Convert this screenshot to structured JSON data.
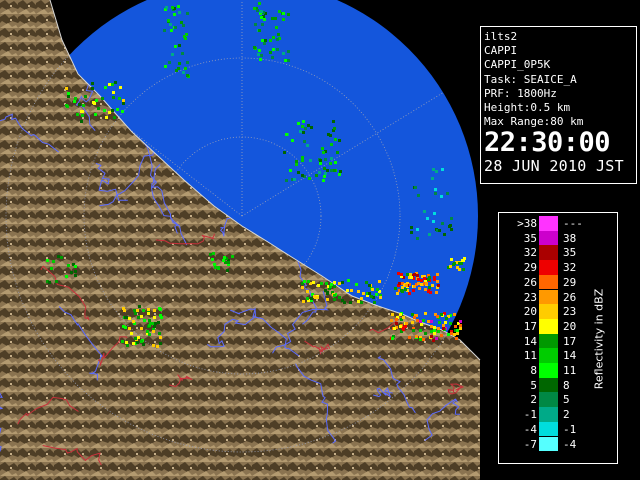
{
  "info": {
    "station": "ilts2",
    "product": "CAPPI",
    "product_code": "CAPPI_0P5K",
    "task": "Task: SEAICE_A",
    "prf": "PRF: 1800Hz",
    "height": "Height:0.5 km",
    "max_range": "Max Range:80 km",
    "time": "22:30:00",
    "date": "28 JUN 2010 JST"
  },
  "legend": {
    "title": "Reflectivity in dBZ",
    "rows": [
      {
        "lo": ">38",
        "hi": "---",
        "color": "#ff33ff"
      },
      {
        "lo": "35",
        "hi": "38",
        "color": "#cc00cc"
      },
      {
        "lo": "32",
        "hi": "35",
        "color": "#aa0000"
      },
      {
        "lo": "29",
        "hi": "32",
        "color": "#ee0000"
      },
      {
        "lo": "26",
        "hi": "29",
        "color": "#ff6600"
      },
      {
        "lo": "23",
        "hi": "26",
        "color": "#ff9900"
      },
      {
        "lo": "20",
        "hi": "23",
        "color": "#ffcc00"
      },
      {
        "lo": "17",
        "hi": "20",
        "color": "#ffff00"
      },
      {
        "lo": "14",
        "hi": "17",
        "color": "#009900"
      },
      {
        "lo": "11",
        "hi": "14",
        "color": "#00cc00"
      },
      {
        "lo": "8",
        "hi": "11",
        "color": "#00ff00"
      },
      {
        "lo": "5",
        "hi": "8",
        "color": "#006600"
      },
      {
        "lo": "2",
        "hi": "5",
        "color": "#008844"
      },
      {
        "lo": "-1",
        "hi": "2",
        "color": "#00aa88"
      },
      {
        "lo": "-4",
        "hi": "-1",
        "color": "#00dddd"
      },
      {
        "lo": "-7",
        "hi": "-4",
        "color": "#55ffff"
      }
    ]
  },
  "colors": {
    "sea": "#1456dc",
    "sea_edge": "#0e4ab8",
    "land": "#8a7350",
    "land_dark": "#4a3a22",
    "river": "#5c6cff",
    "border": "#c8323c",
    "range_ring": "#9aa0b8"
  }
}
